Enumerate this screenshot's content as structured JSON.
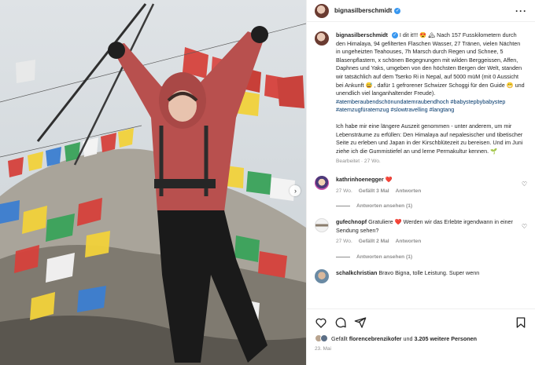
{
  "post": {
    "author": "bignasilberschmidt",
    "caption_lines": [
      "I dit it!!! 😍 🏔 Nach 157 Fusskilometern durch den Himalaya, 94 gefilterten Flaschen Wasser, 27 Tränen, vielen Nächten in ungeheizten Teahouses, 7h Marsch durch Regen und Schnee, 5 Blasenpflastern, x schönen Begegnungen mit wilden Berggeissen, Affen, Daphnes und Yaks, umgeben von den höchsten Bergen der Welt, standen wir tatsächlich auf dem Tserko Ri in Nepal, auf 5000 müM (mit 0 Aussicht bei Ankunft 😅 , dafür 1 gefrorener Schwizer Schoggi für den Guide 😁 und unendlich viel langanhaltender Freude)."
    ],
    "hashtags": "#atemberaubendschönundatemraubendhoch #babystepbybabystep #atemzugfüratemzug #slowtravelling #langtang",
    "paragraph2": "Ich habe mir eine längere Auszeit genommen - unter anderem, um mir Lebensträume zu erfüllen: Den Himalaya auf nepalesischer und tibetischer Seite zu erleben und Japan in der Kirschblütezeit zu bereisen. Und im Juni ziehe ich die Gummistiefel an und lerne Permakultur kennen. 🌱",
    "edited": "Bearbeitet · 27 Wo."
  },
  "comments": [
    {
      "user": "kathrinhoenegger",
      "text": "❤️",
      "time": "27 Wo.",
      "likes": "Gefällt 3 Mal",
      "reply": "Antworten",
      "replies": "Antworten ansehen (1)"
    },
    {
      "user": "gufechnopf",
      "text": "Gratuliere ❤️ Werden wir das Erlebte irgendwann in einer Sendung sehen?",
      "time": "27 Wo.",
      "likes": "Gefällt 2 Mal",
      "reply": "Antworten",
      "replies": "Antworten ansehen (1)"
    },
    {
      "user": "schalkchristian",
      "text": "Bravo Bigna, tolle Leistung. Super wenn",
      "time": "",
      "likes": "",
      "reply": "",
      "replies": ""
    }
  ],
  "footer": {
    "likes_prefix": "Gefällt ",
    "liker": "florencebrenzikofer",
    "likes_mid": " und ",
    "likes_count": "3.205 weitere Personen",
    "date": "23. Mai"
  },
  "icons": {
    "more": "more-horizontal-icon",
    "verified": "verified-badge-icon",
    "like": "heart-icon",
    "comment": "comment-icon",
    "share": "share-icon",
    "save": "bookmark-icon",
    "next": "chevron-right-icon"
  },
  "colors": {
    "link": "#00376b",
    "verified": "#3897f0",
    "heart": "#ed4956",
    "muted": "#8e8e8e"
  }
}
